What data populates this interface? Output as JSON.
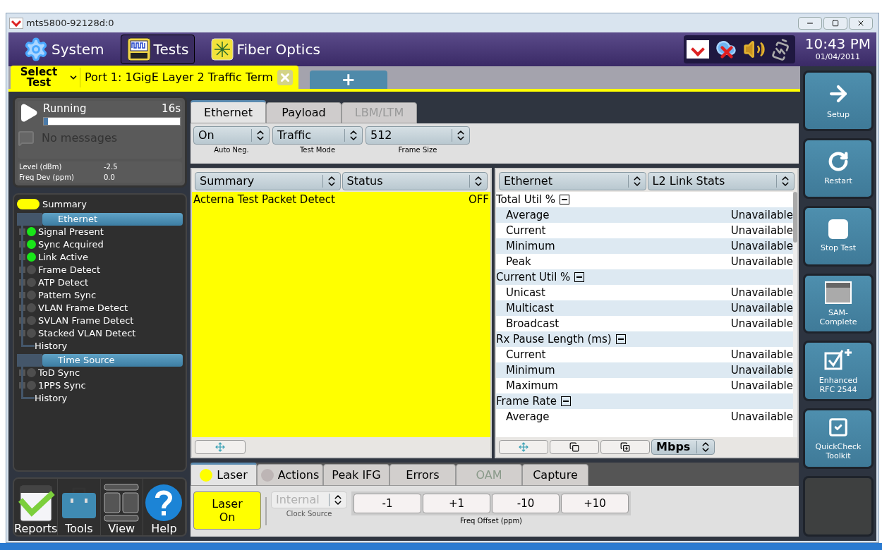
{
  "window": {
    "title": "mts5800-92128d:0"
  },
  "header": {
    "items": [
      {
        "label": "System",
        "kind": "gear",
        "selected": false
      },
      {
        "label": "Tests",
        "kind": "bert",
        "selected": true
      },
      {
        "label": "Fiber Optics",
        "kind": "fiber",
        "selected": false
      }
    ],
    "time": "10:43 PM",
    "date": "01/04/2011"
  },
  "test_tabs": {
    "select_label": "Select Test",
    "active": "Port 1: 1GigE Layer 2 Traffic Term",
    "add": "+"
  },
  "status": {
    "state": "Running",
    "elapsed": "16s",
    "level": 0.03,
    "messages": "No messages",
    "readings": [
      {
        "label": "Level (dBm)",
        "value": "-2.5"
      },
      {
        "label": "Freq Dev (ppm)",
        "value": "0.0"
      }
    ]
  },
  "tree": {
    "summary": {
      "label": "Summary",
      "color": "#ffff00"
    },
    "groups": [
      {
        "title": "Ethernet",
        "children": [
          {
            "label": "Signal Present",
            "kind": "led",
            "on": true
          },
          {
            "label": "Sync Acquired",
            "kind": "led",
            "on": true
          },
          {
            "label": "Link Active",
            "kind": "led",
            "on": true
          },
          {
            "label": "Frame Detect",
            "kind": "led",
            "on": false
          },
          {
            "label": "ATP Detect",
            "kind": "led",
            "on": false
          },
          {
            "label": "Pattern Sync",
            "kind": "led",
            "on": false
          },
          {
            "label": "VLAN Frame Detect",
            "kind": "led",
            "on": false
          },
          {
            "label": "SVLAN Frame Detect",
            "kind": "led",
            "on": false
          },
          {
            "label": "Stacked VLAN Detect",
            "kind": "led",
            "on": false
          },
          {
            "label": "History",
            "kind": "link"
          }
        ]
      },
      {
        "title": "Time Source",
        "children": [
          {
            "label": "ToD Sync",
            "kind": "led",
            "on": false
          },
          {
            "label": "1PPS Sync",
            "kind": "led",
            "on": false
          },
          {
            "label": "History",
            "kind": "link"
          }
        ]
      }
    ]
  },
  "tools": [
    {
      "label": "Reports",
      "kind": "reports"
    },
    {
      "label": "Tools",
      "kind": "toolbox"
    },
    {
      "label": "View",
      "kind": "view"
    },
    {
      "label": "Help",
      "kind": "help"
    }
  ],
  "config": {
    "tabs": [
      {
        "label": "Ethernet",
        "selected": true,
        "disabled": false
      },
      {
        "label": "Payload",
        "selected": false,
        "disabled": false
      },
      {
        "label": "LBM/LTM",
        "selected": false,
        "disabled": true
      }
    ],
    "fields": [
      {
        "value": "On",
        "label": "Auto Neg."
      },
      {
        "value": "Traffic",
        "label": "Test Mode"
      },
      {
        "value": "512",
        "label": "Frame Size"
      }
    ]
  },
  "summary_panel": {
    "selectors": [
      "Summary",
      "Status"
    ],
    "rows": [
      {
        "label": "Acterna Test Packet Detect",
        "value": "OFF"
      }
    ]
  },
  "stats_panel": {
    "selectors": [
      "Ethernet",
      "L2 Link Stats"
    ],
    "groups": [
      {
        "title": "Total Util %",
        "expanded": true,
        "rows": [
          {
            "label": "Average",
            "value": "Unavailable"
          },
          {
            "label": "Current",
            "value": "Unavailable"
          },
          {
            "label": "Minimum",
            "value": "Unavailable"
          },
          {
            "label": "Peak",
            "value": "Unavailable"
          }
        ]
      },
      {
        "title": "Current Util %",
        "expanded": true,
        "rows": [
          {
            "label": "Unicast",
            "value": "Unavailable"
          },
          {
            "label": "Multicast",
            "value": "Unavailable"
          },
          {
            "label": "Broadcast",
            "value": "Unavailable"
          }
        ]
      },
      {
        "title": "Rx Pause Length (ms)",
        "expanded": true,
        "rows": [
          {
            "label": "Current",
            "value": "Unavailable"
          },
          {
            "label": "Minimum",
            "value": "Unavailable"
          },
          {
            "label": "Maximum",
            "value": "Unavailable"
          }
        ]
      },
      {
        "title": "Frame Rate",
        "expanded": true,
        "rows": [
          {
            "label": "Average",
            "value": "Unavailable"
          }
        ]
      }
    ],
    "unit": "Mbps"
  },
  "bottom": {
    "tabs": [
      {
        "label": "Laser",
        "selected": true,
        "disabled": false,
        "color": "#ffff00"
      },
      {
        "label": "Actions",
        "selected": false,
        "disabled": false,
        "color": "#bdb5b5"
      },
      {
        "label": "Peak IFG",
        "selected": false,
        "disabled": false
      },
      {
        "label": "Errors",
        "selected": false,
        "disabled": false
      },
      {
        "label": "OAM",
        "selected": false,
        "disabled": true
      },
      {
        "label": "Capture",
        "selected": false,
        "disabled": false
      }
    ],
    "laser_button": {
      "label": "Laser On",
      "on": true
    },
    "clock": {
      "value": "Internal",
      "label": "Clock Source",
      "disabled": true
    },
    "offsets": [
      "-1",
      "+1",
      "-10",
      "+10"
    ],
    "offset_label": "Freq Offset (ppm)"
  },
  "actions": [
    {
      "label": "Setup",
      "kind": "arrow"
    },
    {
      "label": "Restart",
      "kind": "restart"
    },
    {
      "label": "Stop Test",
      "kind": "stop"
    },
    {
      "label": "SAM-Complete",
      "kind": "window"
    },
    {
      "label": "Enhanced RFC 2544",
      "kind": "check-plus"
    },
    {
      "label": "QuickCheck Toolkit",
      "kind": "check"
    },
    {
      "kind": "empty"
    }
  ]
}
